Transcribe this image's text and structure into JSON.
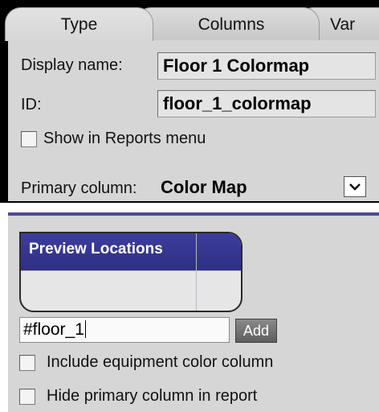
{
  "tabs": [
    {
      "label": "Type",
      "active": true
    },
    {
      "label": "Columns",
      "active": false
    },
    {
      "label": "Var",
      "active": false
    }
  ],
  "props": {
    "display_name_label": "Display name:",
    "display_name_value": "Floor 1 Colormap",
    "id_label": "ID:",
    "id_value": "floor_1_colormap",
    "show_in_reports_label": "Show in Reports menu",
    "show_in_reports_checked": false,
    "primary_column_label": "Primary column:",
    "primary_column_value": "Color Map"
  },
  "preview": {
    "table_header": "Preview Locations",
    "location_input_value": "#floor_1",
    "add_label": "Add",
    "include_equipment_label": "Include equipment color column",
    "include_equipment_checked": false,
    "hide_primary_label": "Hide primary column in report",
    "hide_primary_checked": false
  },
  "colors": {
    "accent": "#3d3d9c",
    "panel": "#d6d6d6",
    "frame": "#000000"
  }
}
